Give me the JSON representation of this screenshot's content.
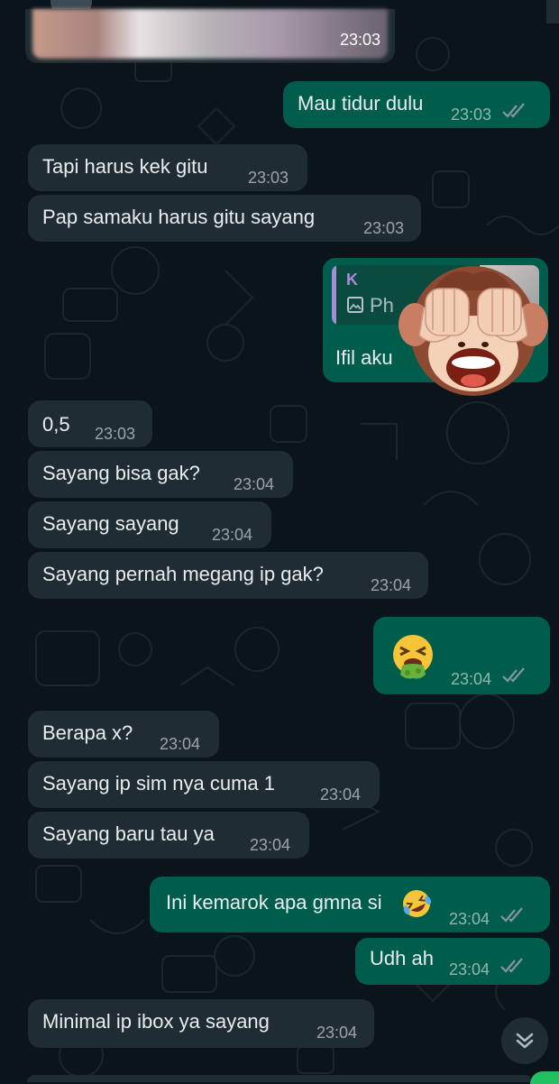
{
  "theme": {
    "background": "#0b141a",
    "incoming": "#202c33",
    "outgoing": "#005c4b",
    "tick_color": "#8696a0",
    "quote_accent": "#a98bd9"
  },
  "image_message": {
    "time": "23:03"
  },
  "messages": [
    {
      "text": "Mau tidur dulu",
      "time": "23:03"
    },
    {
      "text": "Tapi harus kek gitu",
      "time": "23:03"
    },
    {
      "text": "Pap samaku harus gitu sayang",
      "time": "23:03"
    },
    {
      "text": "0,5",
      "time": "23:03"
    },
    {
      "text": "Sayang bisa gak?",
      "time": "23:04"
    },
    {
      "text": "Sayang sayang",
      "time": "23:04"
    },
    {
      "text": "Sayang pernah megang ip gak?",
      "time": "23:04"
    },
    {
      "text": "",
      "time": "23:04"
    },
    {
      "text": "Berapa x?",
      "time": "23:04"
    },
    {
      "text": "Sayang ip sim nya cuma 1",
      "time": "23:04"
    },
    {
      "text": "Sayang baru tau ya",
      "time": "23:04"
    },
    {
      "text": "Ini kemarok apa gmna si",
      "time": "23:04"
    },
    {
      "text": "Udh ah",
      "time": "23:04"
    },
    {
      "text": "Minimal ip ibox ya sayang",
      "time": "23:04"
    }
  ],
  "reply_message": {
    "quote_author": "K",
    "quote_preview": "Ph",
    "text": "Ifil aku"
  },
  "icons": {
    "read_receipt": "double-check-icon",
    "scroll": "double-chevron-down-icon",
    "emoji_sick": "face-vomiting-emoji",
    "emoji_laugh": "rolling-on-floor-laughing-emoji",
    "sticker": "see-no-evil-monkey-sticker"
  }
}
